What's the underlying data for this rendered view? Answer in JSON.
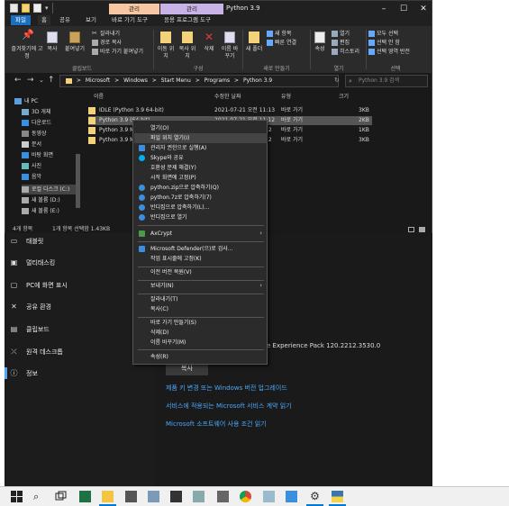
{
  "explorer": {
    "titlebar": {
      "context_tab_1": "관리",
      "context_tab_2": "관리",
      "context_sub_1": "바로 가기 도구",
      "context_sub_2": "응용 프로그램 도구",
      "title": "Python 3.9",
      "tabs": [
        "파일",
        "홈",
        "공유",
        "보기"
      ]
    },
    "ribbon": {
      "pin_label": "즐겨찾기에 고정",
      "copy_label": "복사",
      "paste_label": "붙여넣기",
      "cut_label": "잘라내기",
      "copy_path_label": "경로 복사",
      "paste_shortcut_label": "바로 가기 붙여넣기",
      "move_label": "이동 위치",
      "copy_to_label": "복사 위치",
      "delete_label": "삭제",
      "rename_label": "이름 바꾸기",
      "new_folder_label": "새 폴더",
      "new_item_label": "새 항목",
      "easy_access_label": "빠른 연결",
      "properties_label": "속성",
      "open_label": "열기",
      "edit_label": "편집",
      "history_label": "히스토리",
      "select_all_label": "모두 선택",
      "select_none_label": "선택 안 함",
      "invert_selection_label": "선택 영역 반전",
      "groups": {
        "clipboard": "클립보드",
        "organize": "구성",
        "new": "새로 만들기",
        "open": "열기",
        "select": "선택"
      }
    },
    "address": {
      "path": [
        "Microsoft",
        "Windows",
        "Start Menu",
        "Programs",
        "Python 3.9"
      ],
      "separator": ">",
      "search_placeholder": "Python 3.9 검색"
    },
    "nav": {
      "items": [
        "내 PC",
        "3D 개체",
        "다운로드",
        "동영상",
        "문서",
        "바탕 화면",
        "사진",
        "음악",
        "로컬 디스크 (C:)",
        "새 볼륨 (D:)",
        "새 볼륨 (E:)"
      ]
    },
    "columns": {
      "name": "이름",
      "modified": "수정한 날짜",
      "type": "유형",
      "size": "크기"
    },
    "files": [
      {
        "name": "IDLE (Python 3.9 64-bit)",
        "date": "2021-07-21 오전 11:13",
        "type": "바로 가기",
        "size": "3KB"
      },
      {
        "name": "Python 3.9 (64-bit)",
        "date": "2021-07-21 오전 11:12",
        "type": "바로 가기",
        "size": "2KB"
      },
      {
        "name": "Python 3.9 M",
        "date": "12",
        "type": "바로 가기",
        "size": "1KB"
      },
      {
        "name": "Python 3.9 M",
        "date": "12",
        "type": "바로 가기",
        "size": "3KB"
      }
    ],
    "status": {
      "count": "4개 항목",
      "selection": "1개 항목 선택함 1.43KB"
    }
  },
  "settings": {
    "left_items": [
      "태블릿",
      "멀티태스킹",
      "PC에 화면 표시",
      "공유 환경",
      "클립보드",
      "원격 데스크톱",
      "정보"
    ],
    "experience_pack": "e Experience Pack 120.2212.3530.0",
    "copy_button": "복사",
    "links": [
      "제품 키 변경 또는 Windows 버전 업그레이드",
      "서비스에 적용되는 Microsoft 서비스 계약 읽기",
      "Microsoft 소프트웨어 사용 조건 읽기"
    ]
  },
  "context_menu": {
    "items": [
      {
        "label": "열기(O)"
      },
      {
        "label": "파일 위치 열기(I)"
      },
      {
        "label": "관리자 권한으로 실행(A)"
      },
      {
        "label": "Skype와 공유"
      },
      {
        "label": "호환성 문제 해결(Y)"
      },
      {
        "label": "시작 화면에 고정(P)"
      },
      {
        "label": "python.zip으로 압축하기(Q)"
      },
      {
        "label": "python.7z로 압축하기(7)"
      },
      {
        "label": "반디집으로 압축하기(L)..."
      },
      {
        "label": "반디집으로 열기"
      },
      {
        "label": "AxCrypt"
      },
      {
        "label": "Microsoft Defender(으)로 검사..."
      },
      {
        "label": "작업 표시줄에 고정(K)"
      },
      {
        "label": "이전 버전 복원(V)"
      },
      {
        "label": "보내기(N)"
      },
      {
        "label": "잘라내기(T)"
      },
      {
        "label": "복사(C)"
      },
      {
        "label": "바로 가기 만들기(S)"
      },
      {
        "label": "삭제(D)"
      },
      {
        "label": "이름 바꾸기(M)"
      },
      {
        "label": "속성(R)"
      }
    ]
  },
  "taskbar": {
    "icons": [
      "windows-start-icon",
      "search-icon",
      "task-view-icon",
      "excel-icon",
      "file-explorer-icon",
      "chip-app-icon",
      "mail-icon",
      "terminal-icon",
      "network-app-icon",
      "calculator-icon",
      "chrome-icon",
      "remote-desktop-icon",
      "photos-icon",
      "settings-icon",
      "python-icon"
    ]
  }
}
